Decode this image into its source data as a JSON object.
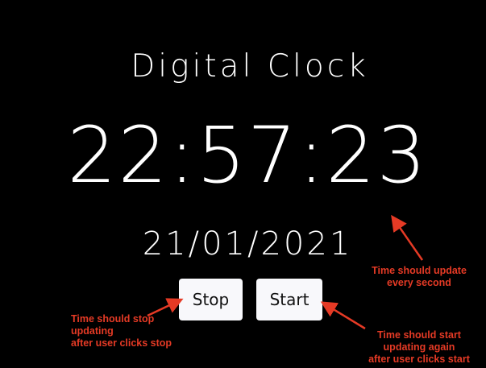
{
  "app": {
    "title": "Digital Clock",
    "time": "22:57:23",
    "date": "21/01/2021"
  },
  "controls": {
    "stop_label": "Stop",
    "start_label": "Start"
  },
  "annotations": {
    "update": [
      "Time should update",
      "every second"
    ],
    "stop": [
      "Time should stop",
      "updating",
      "after user clicks stop"
    ],
    "start": [
      "Time should start",
      "updating again",
      "after user clicks start"
    ]
  },
  "colors": {
    "background": "#000000",
    "text": "#ffffff",
    "button_bg": "#f8f8fb",
    "annotation": "#e53a25"
  }
}
